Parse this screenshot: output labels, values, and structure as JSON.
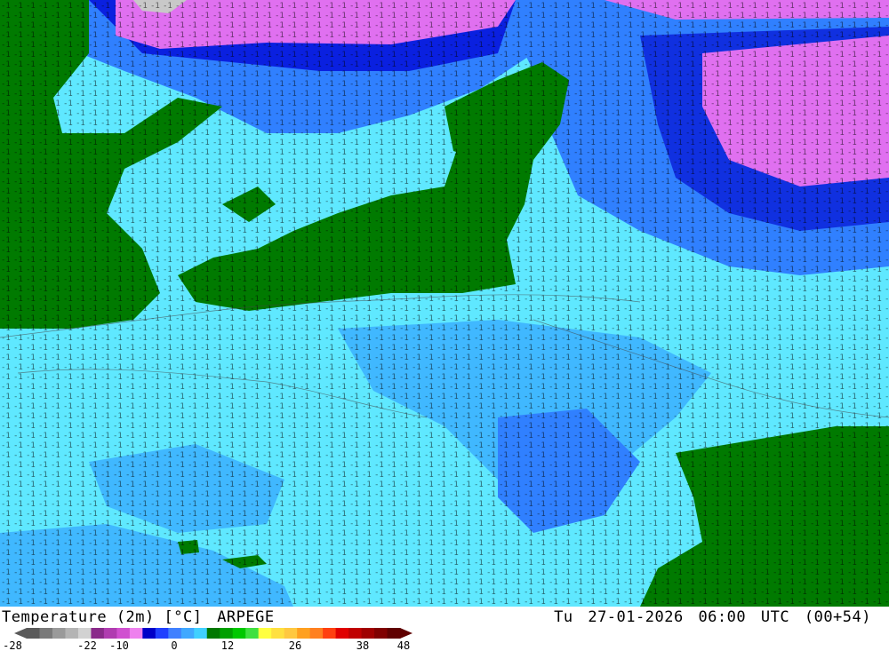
{
  "header": {
    "variable": "Temperature (2m) [°C]",
    "model": "ARPEGE",
    "day": "Tu",
    "date": "27-01-2026",
    "time": "06:00",
    "timezone": "UTC",
    "forecast_hour": "(00+54)"
  },
  "legend": {
    "ticks": [
      "-28",
      "-22",
      "-10",
      "0",
      "12",
      "26",
      "38",
      "48"
    ],
    "colors": [
      "#5a5a5a",
      "#7a7a7a",
      "#9a9a9a",
      "#b4b4b4",
      "#d2d2d2",
      "#8a2a8a",
      "#b03cb0",
      "#d050d0",
      "#ee80ee",
      "#0000c8",
      "#2040ff",
      "#4080ff",
      "#40a8ff",
      "#40d0ff",
      "#007800",
      "#00a000",
      "#00c800",
      "#40e040",
      "#ffff40",
      "#ffe040",
      "#ffc840",
      "#ffa020",
      "#ff8020",
      "#ff4010",
      "#e00000",
      "#c00000",
      "#a00000",
      "#800000",
      "#600000"
    ]
  },
  "map": {
    "palette": {
      "cyan_light": "#60f0ff",
      "cyan": "#40d8ff",
      "blue_light": "#40a8ff",
      "blue": "#3080ff",
      "blue_mid": "#2050ff",
      "blue_dark": "#0010d8",
      "magenta": "#ee70ee",
      "pink_light": "#ff90ff",
      "green": "#007800",
      "grey": "#c0c0c0"
    },
    "label_color": "#000000"
  }
}
